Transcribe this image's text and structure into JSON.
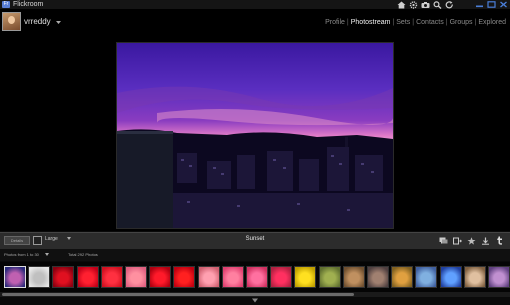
{
  "app": {
    "title": "Flickroom",
    "icon_label": "Fr"
  },
  "toolbar_icons": [
    "home-icon",
    "settings-icon",
    "camera-icon",
    "search-icon",
    "refresh-icon"
  ],
  "window_controls": [
    "minimize-icon",
    "maximize-icon",
    "close-icon"
  ],
  "header": {
    "username": "vrreddy",
    "nav": [
      {
        "label": "Profile",
        "active": false
      },
      {
        "label": "Photostream",
        "active": true
      },
      {
        "label": "Sets",
        "active": false
      },
      {
        "label": "Contacts",
        "active": false
      },
      {
        "label": "Groups",
        "active": false
      },
      {
        "label": "Explored",
        "active": false
      }
    ]
  },
  "viewer": {
    "photo_title": "Sunset",
    "button_label": "Details",
    "size_label": "Large"
  },
  "actions": [
    "comment-icon",
    "add-to-set-icon",
    "favorite-icon",
    "download-icon",
    "tumblr-icon"
  ],
  "info": {
    "range": "Photos from 1 to 30",
    "total": "Total 292 Photos"
  },
  "thumbnails": [
    {
      "colors": [
        "#2a2a7a",
        "#c060b0"
      ]
    },
    {
      "colors": [
        "#e8e8e8",
        "#c0c0c0"
      ]
    },
    {
      "colors": [
        "#8a0010",
        "#e01020"
      ]
    },
    {
      "colors": [
        "#c00018",
        "#ff2030"
      ]
    },
    {
      "colors": [
        "#d01020",
        "#ff3040"
      ]
    },
    {
      "colors": [
        "#e06080",
        "#ff90a0"
      ]
    },
    {
      "colors": [
        "#b00010",
        "#ff1a2a"
      ]
    },
    {
      "colors": [
        "#c00010",
        "#ff2020"
      ]
    },
    {
      "colors": [
        "#d06070",
        "#ffa0b0"
      ]
    },
    {
      "colors": [
        "#e04070",
        "#ff80a0"
      ]
    },
    {
      "colors": [
        "#d03060",
        "#ff70a0"
      ]
    },
    {
      "colors": [
        "#b02040",
        "#ff3060"
      ]
    },
    {
      "colors": [
        "#c0a000",
        "#ffe020"
      ]
    },
    {
      "colors": [
        "#607030",
        "#a0b050"
      ]
    },
    {
      "colors": [
        "#705030",
        "#c09060"
      ]
    },
    {
      "colors": [
        "#504040",
        "#a08070"
      ]
    },
    {
      "colors": [
        "#806020",
        "#e0a040"
      ]
    },
    {
      "colors": [
        "#4060a0",
        "#80b0e0"
      ]
    },
    {
      "colors": [
        "#2040a0",
        "#60a0ff"
      ]
    },
    {
      "colors": [
        "#806040",
        "#e0c0a0"
      ]
    },
    {
      "colors": [
        "#604080",
        "#c090d0"
      ]
    }
  ],
  "colors": {
    "accent": "#5a7fd6",
    "active_nav": "#f0f0f0",
    "inactive_nav": "#8a8a8a"
  }
}
